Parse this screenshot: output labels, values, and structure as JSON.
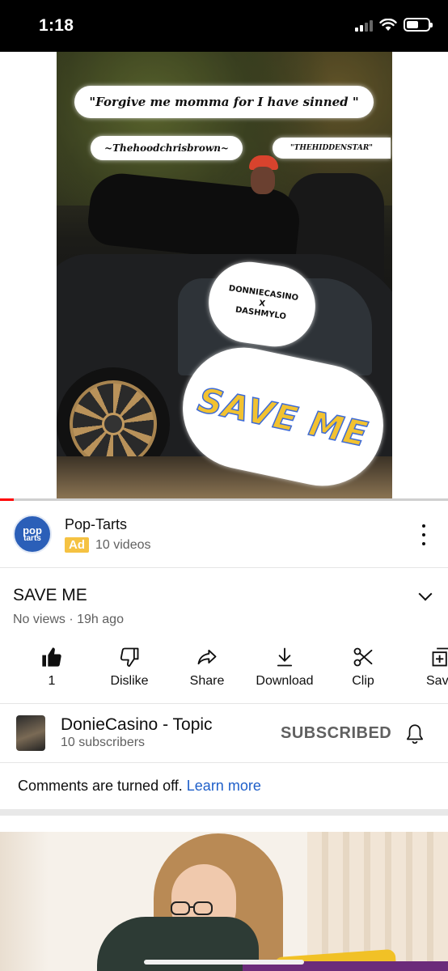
{
  "status_bar": {
    "time": "1:18"
  },
  "cover": {
    "quote": "\"Forgive me momma for I have sinned \"",
    "tag_left": "~Thehoodchrisbrown~",
    "tag_right": "\"THEHIDDENSTAR\"",
    "artists_line1": "DONNIECASINO",
    "artists_line2": "X",
    "artists_line3": "DASHMYLO",
    "big_title": "SAVE ME"
  },
  "progress": {
    "fraction": 0.03
  },
  "ad": {
    "logo_text_1": "pop",
    "logo_text_2": "tarts",
    "name": "Pop-Tarts",
    "badge": "Ad",
    "meta": "10 videos"
  },
  "video": {
    "title": "SAVE ME",
    "meta": "No views · 19h ago"
  },
  "actions": [
    {
      "label": "1",
      "icon": "thumbs-up-filled-icon"
    },
    {
      "label": "Dislike",
      "icon": "thumbs-down-icon"
    },
    {
      "label": "Share",
      "icon": "share-icon"
    },
    {
      "label": "Download",
      "icon": "download-icon"
    },
    {
      "label": "Clip",
      "icon": "scissors-icon"
    },
    {
      "label": "Sav",
      "icon": "save-playlist-icon"
    }
  ],
  "channel": {
    "name": "DonieCasino - Topic",
    "subscribers": "10 subscribers",
    "subscribe_label": "SUBSCRIBED"
  },
  "comments": {
    "text": "Comments are turned off.",
    "link": "Learn more"
  },
  "colors": {
    "accent_red": "#ff0000",
    "link_blue": "#1f5fc9",
    "ad_badge": "#f5c242",
    "brand_blue": "#2b5fb8"
  }
}
